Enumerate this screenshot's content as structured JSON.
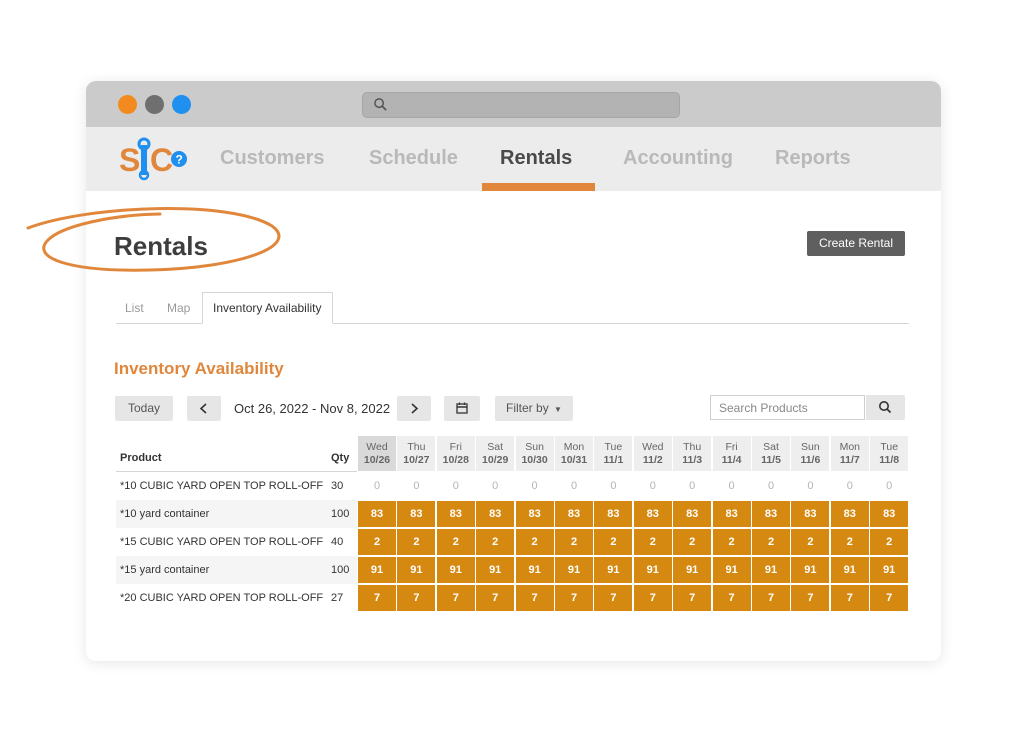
{
  "nav": {
    "items": [
      {
        "label": "Customers"
      },
      {
        "label": "Schedule"
      },
      {
        "label": "Rentals"
      },
      {
        "label": "Accounting"
      },
      {
        "label": "Reports"
      }
    ],
    "active": "Rentals"
  },
  "brand": {
    "logo_text": "SJC",
    "accent": "#e0873c",
    "logo_blue": "#1f8ff0",
    "cell_color": "#d68910"
  },
  "page": {
    "title": "Rentals",
    "create_button": "Create Rental"
  },
  "tabs": [
    {
      "label": "List"
    },
    {
      "label": "Map"
    },
    {
      "label": "Inventory Availability"
    }
  ],
  "availability": {
    "title": "Inventory Availability",
    "today_button": "Today",
    "prev_icon": "chevron-left-icon",
    "next_icon": "chevron-right-icon",
    "date_range": "Oct 26, 2022 - Nov 8, 2022",
    "calendar_icon": "calendar-icon",
    "filter_label": "Filter by",
    "search_placeholder": "Search Products",
    "columns": {
      "product": "Product",
      "qty": "Qty"
    },
    "days": [
      {
        "dow": "Wed",
        "date": "10/26"
      },
      {
        "dow": "Thu",
        "date": "10/27"
      },
      {
        "dow": "Fri",
        "date": "10/28"
      },
      {
        "dow": "Sat",
        "date": "10/29"
      },
      {
        "dow": "Sun",
        "date": "10/30"
      },
      {
        "dow": "Mon",
        "date": "10/31"
      },
      {
        "dow": "Tue",
        "date": "11/1"
      },
      {
        "dow": "Wed",
        "date": "11/2"
      },
      {
        "dow": "Thu",
        "date": "11/3"
      },
      {
        "dow": "Fri",
        "date": "11/4"
      },
      {
        "dow": "Sat",
        "date": "11/5"
      },
      {
        "dow": "Sun",
        "date": "11/6"
      },
      {
        "dow": "Mon",
        "date": "11/7"
      },
      {
        "dow": "Tue",
        "date": "11/8"
      }
    ],
    "rows": [
      {
        "product": "*10 CUBIC YARD OPEN TOP ROLL-OFF",
        "qty": "30",
        "values": [
          "0",
          "0",
          "0",
          "0",
          "0",
          "0",
          "0",
          "0",
          "0",
          "0",
          "0",
          "0",
          "0",
          "0"
        ]
      },
      {
        "product": "*10 yard container",
        "qty": "100",
        "values": [
          "83",
          "83",
          "83",
          "83",
          "83",
          "83",
          "83",
          "83",
          "83",
          "83",
          "83",
          "83",
          "83",
          "83"
        ]
      },
      {
        "product": "*15 CUBIC YARD OPEN TOP ROLL-OFF",
        "qty": "40",
        "values": [
          "2",
          "2",
          "2",
          "2",
          "2",
          "2",
          "2",
          "2",
          "2",
          "2",
          "2",
          "2",
          "2",
          "2"
        ]
      },
      {
        "product": "*15 yard container",
        "qty": "100",
        "values": [
          "91",
          "91",
          "91",
          "91",
          "91",
          "91",
          "91",
          "91",
          "91",
          "91",
          "91",
          "91",
          "91",
          "91"
        ]
      },
      {
        "product": "*20 CUBIC YARD OPEN TOP ROLL-OFF",
        "qty": "27",
        "values": [
          "7",
          "7",
          "7",
          "7",
          "7",
          "7",
          "7",
          "7",
          "7",
          "7",
          "7",
          "7",
          "7",
          "7"
        ]
      }
    ]
  }
}
